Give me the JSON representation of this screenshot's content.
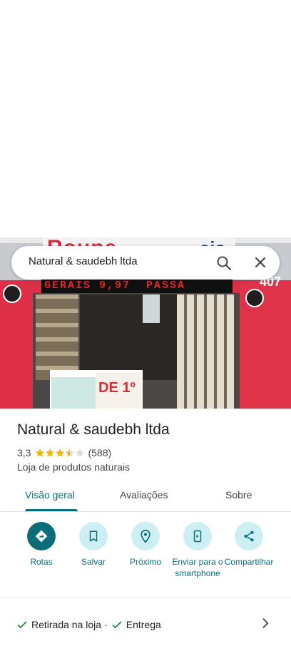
{
  "search": {
    "query": "Natural & saudebh ltda"
  },
  "place": {
    "name": "Natural & saudebh ltda",
    "rating": "3,3",
    "stars_value": 3.3,
    "review_count": "(588)",
    "category": "Loja de produtos naturais"
  },
  "tabs": [
    {
      "label": "Visão geral",
      "active": true
    },
    {
      "label": "Avaliações",
      "active": false
    },
    {
      "label": "Sobre",
      "active": false
    }
  ],
  "actions": [
    {
      "label": "Rotas",
      "icon": "directions-icon"
    },
    {
      "label": "Salvar",
      "icon": "bookmark-icon"
    },
    {
      "label": "Próximo",
      "icon": "nearby-icon"
    },
    {
      "label": "Enviar para o smartphone",
      "icon": "send-to-phone-icon"
    },
    {
      "label": "Compartilhar",
      "icon": "share-icon"
    }
  ],
  "services": {
    "items": [
      "Retirada na loja",
      "Entrega"
    ],
    "separator": "·"
  },
  "colors": {
    "accent": "#0b6d78",
    "action_bg": "#cdeff3",
    "star": "#f4b400",
    "check": "#188038"
  }
}
